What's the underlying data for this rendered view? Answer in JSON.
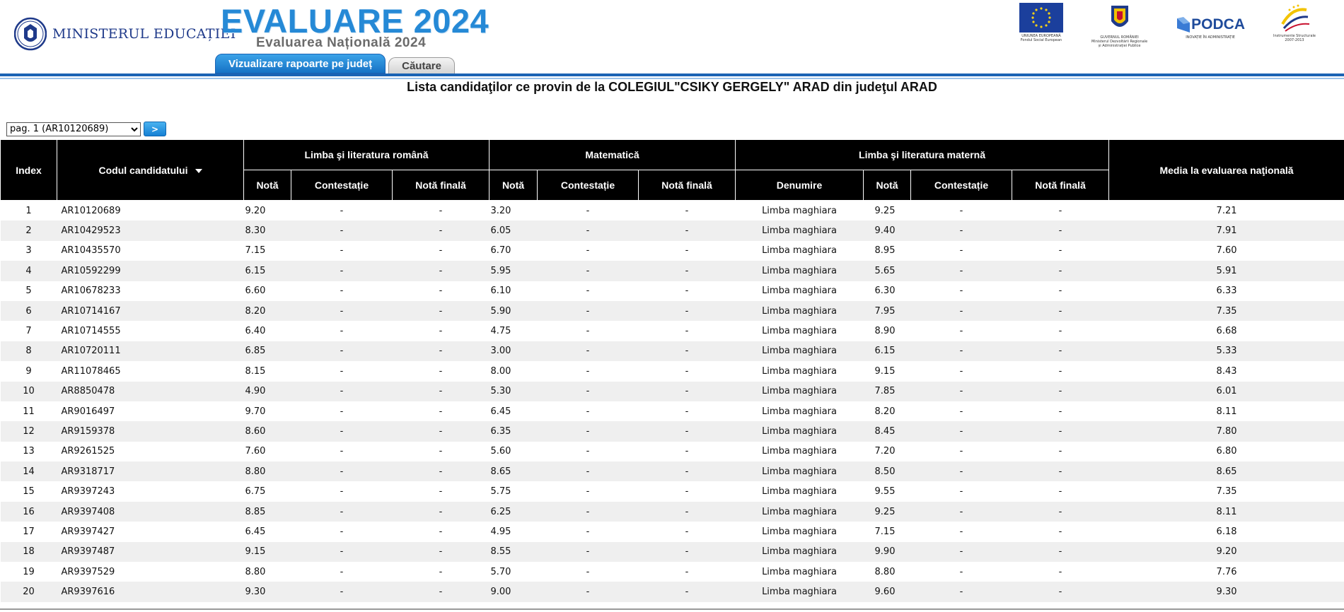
{
  "header": {
    "ministry": "MINISTERUL EDUCAȚIEI",
    "title": "EVALUARE 2024",
    "subtitle": "Evaluarea Națională 2024",
    "tabs": [
      {
        "label": "Vizualizare rapoarte pe județ",
        "active": true
      },
      {
        "label": "Căutare",
        "active": false
      }
    ],
    "logos": {
      "eu_caption": "UNIUNEA EUROPEANĂ\nFondul Social European",
      "gov_caption": "GUVERNUL ROMÂNIEI\nMinisterul Dezvoltării Regionale\nși Administrației Publice",
      "podca": "PODCA",
      "podca_tagline": "INOVAȚIE ÎN ADMINISTRAȚIE",
      "is_caption": "Instrumente Structurale\n2007-2013"
    }
  },
  "page_title": "Lista candidaţilor ce provin de la COLEGIUL\"CSIKY GERGELY\" ARAD din judeţul ARAD",
  "pager": {
    "selected": "pag. 1 (AR10120689)",
    "go_label": ">"
  },
  "table": {
    "headers": {
      "index": "Index",
      "code": "Codul candidatului",
      "romana": "Limba şi literatura română",
      "matematica": "Matematică",
      "materna": "Limba şi literatura maternă",
      "media": "Media la evaluarea naţională",
      "nota": "Notă",
      "contestatie": "Contestație",
      "nota_finala": "Notă finală",
      "denumire": "Denumire"
    },
    "rows": [
      {
        "index": "1",
        "code": "AR10120689",
        "ro_nota": "9.20",
        "ro_cont": "-",
        "ro_final": "-",
        "mat_nota": "3.20",
        "mat_cont": "-",
        "mat_final": "-",
        "lm_den": "Limba maghiara",
        "lm_nota": "9.25",
        "lm_cont": "-",
        "lm_final": "-",
        "media": "7.21"
      },
      {
        "index": "2",
        "code": "AR10429523",
        "ro_nota": "8.30",
        "ro_cont": "-",
        "ro_final": "-",
        "mat_nota": "6.05",
        "mat_cont": "-",
        "mat_final": "-",
        "lm_den": "Limba maghiara",
        "lm_nota": "9.40",
        "lm_cont": "-",
        "lm_final": "-",
        "media": "7.91"
      },
      {
        "index": "3",
        "code": "AR10435570",
        "ro_nota": "7.15",
        "ro_cont": "-",
        "ro_final": "-",
        "mat_nota": "6.70",
        "mat_cont": "-",
        "mat_final": "-",
        "lm_den": "Limba maghiara",
        "lm_nota": "8.95",
        "lm_cont": "-",
        "lm_final": "-",
        "media": "7.60"
      },
      {
        "index": "4",
        "code": "AR10592299",
        "ro_nota": "6.15",
        "ro_cont": "-",
        "ro_final": "-",
        "mat_nota": "5.95",
        "mat_cont": "-",
        "mat_final": "-",
        "lm_den": "Limba maghiara",
        "lm_nota": "5.65",
        "lm_cont": "-",
        "lm_final": "-",
        "media": "5.91"
      },
      {
        "index": "5",
        "code": "AR10678233",
        "ro_nota": "6.60",
        "ro_cont": "-",
        "ro_final": "-",
        "mat_nota": "6.10",
        "mat_cont": "-",
        "mat_final": "-",
        "lm_den": "Limba maghiara",
        "lm_nota": "6.30",
        "lm_cont": "-",
        "lm_final": "-",
        "media": "6.33"
      },
      {
        "index": "6",
        "code": "AR10714167",
        "ro_nota": "8.20",
        "ro_cont": "-",
        "ro_final": "-",
        "mat_nota": "5.90",
        "mat_cont": "-",
        "mat_final": "-",
        "lm_den": "Limba maghiara",
        "lm_nota": "7.95",
        "lm_cont": "-",
        "lm_final": "-",
        "media": "7.35"
      },
      {
        "index": "7",
        "code": "AR10714555",
        "ro_nota": "6.40",
        "ro_cont": "-",
        "ro_final": "-",
        "mat_nota": "4.75",
        "mat_cont": "-",
        "mat_final": "-",
        "lm_den": "Limba maghiara",
        "lm_nota": "8.90",
        "lm_cont": "-",
        "lm_final": "-",
        "media": "6.68"
      },
      {
        "index": "8",
        "code": "AR10720111",
        "ro_nota": "6.85",
        "ro_cont": "-",
        "ro_final": "-",
        "mat_nota": "3.00",
        "mat_cont": "-",
        "mat_final": "-",
        "lm_den": "Limba maghiara",
        "lm_nota": "6.15",
        "lm_cont": "-",
        "lm_final": "-",
        "media": "5.33"
      },
      {
        "index": "9",
        "code": "AR11078465",
        "ro_nota": "8.15",
        "ro_cont": "-",
        "ro_final": "-",
        "mat_nota": "8.00",
        "mat_cont": "-",
        "mat_final": "-",
        "lm_den": "Limba maghiara",
        "lm_nota": "9.15",
        "lm_cont": "-",
        "lm_final": "-",
        "media": "8.43"
      },
      {
        "index": "10",
        "code": "AR8850478",
        "ro_nota": "4.90",
        "ro_cont": "-",
        "ro_final": "-",
        "mat_nota": "5.30",
        "mat_cont": "-",
        "mat_final": "-",
        "lm_den": "Limba maghiara",
        "lm_nota": "7.85",
        "lm_cont": "-",
        "lm_final": "-",
        "media": "6.01"
      },
      {
        "index": "11",
        "code": "AR9016497",
        "ro_nota": "9.70",
        "ro_cont": "-",
        "ro_final": "-",
        "mat_nota": "6.45",
        "mat_cont": "-",
        "mat_final": "-",
        "lm_den": "Limba maghiara",
        "lm_nota": "8.20",
        "lm_cont": "-",
        "lm_final": "-",
        "media": "8.11"
      },
      {
        "index": "12",
        "code": "AR9159378",
        "ro_nota": "8.60",
        "ro_cont": "-",
        "ro_final": "-",
        "mat_nota": "6.35",
        "mat_cont": "-",
        "mat_final": "-",
        "lm_den": "Limba maghiara",
        "lm_nota": "8.45",
        "lm_cont": "-",
        "lm_final": "-",
        "media": "7.80"
      },
      {
        "index": "13",
        "code": "AR9261525",
        "ro_nota": "7.60",
        "ro_cont": "-",
        "ro_final": "-",
        "mat_nota": "5.60",
        "mat_cont": "-",
        "mat_final": "-",
        "lm_den": "Limba maghiara",
        "lm_nota": "7.20",
        "lm_cont": "-",
        "lm_final": "-",
        "media": "6.80"
      },
      {
        "index": "14",
        "code": "AR9318717",
        "ro_nota": "8.80",
        "ro_cont": "-",
        "ro_final": "-",
        "mat_nota": "8.65",
        "mat_cont": "-",
        "mat_final": "-",
        "lm_den": "Limba maghiara",
        "lm_nota": "8.50",
        "lm_cont": "-",
        "lm_final": "-",
        "media": "8.65"
      },
      {
        "index": "15",
        "code": "AR9397243",
        "ro_nota": "6.75",
        "ro_cont": "-",
        "ro_final": "-",
        "mat_nota": "5.75",
        "mat_cont": "-",
        "mat_final": "-",
        "lm_den": "Limba maghiara",
        "lm_nota": "9.55",
        "lm_cont": "-",
        "lm_final": "-",
        "media": "7.35"
      },
      {
        "index": "16",
        "code": "AR9397408",
        "ro_nota": "8.85",
        "ro_cont": "-",
        "ro_final": "-",
        "mat_nota": "6.25",
        "mat_cont": "-",
        "mat_final": "-",
        "lm_den": "Limba maghiara",
        "lm_nota": "9.25",
        "lm_cont": "-",
        "lm_final": "-",
        "media": "8.11"
      },
      {
        "index": "17",
        "code": "AR9397427",
        "ro_nota": "6.45",
        "ro_cont": "-",
        "ro_final": "-",
        "mat_nota": "4.95",
        "mat_cont": "-",
        "mat_final": "-",
        "lm_den": "Limba maghiara",
        "lm_nota": "7.15",
        "lm_cont": "-",
        "lm_final": "-",
        "media": "6.18"
      },
      {
        "index": "18",
        "code": "AR9397487",
        "ro_nota": "9.15",
        "ro_cont": "-",
        "ro_final": "-",
        "mat_nota": "8.55",
        "mat_cont": "-",
        "mat_final": "-",
        "lm_den": "Limba maghiara",
        "lm_nota": "9.90",
        "lm_cont": "-",
        "lm_final": "-",
        "media": "9.20"
      },
      {
        "index": "19",
        "code": "AR9397529",
        "ro_nota": "8.80",
        "ro_cont": "-",
        "ro_final": "-",
        "mat_nota": "5.70",
        "mat_cont": "-",
        "mat_final": "-",
        "lm_den": "Limba maghiara",
        "lm_nota": "8.80",
        "lm_cont": "-",
        "lm_final": "-",
        "media": "7.76"
      },
      {
        "index": "20",
        "code": "AR9397616",
        "ro_nota": "9.30",
        "ro_cont": "-",
        "ro_final": "-",
        "mat_nota": "9.00",
        "mat_cont": "-",
        "mat_final": "-",
        "lm_den": "Limba maghiara",
        "lm_nota": "9.60",
        "lm_cont": "-",
        "lm_final": "-",
        "media": "9.30"
      }
    ]
  }
}
